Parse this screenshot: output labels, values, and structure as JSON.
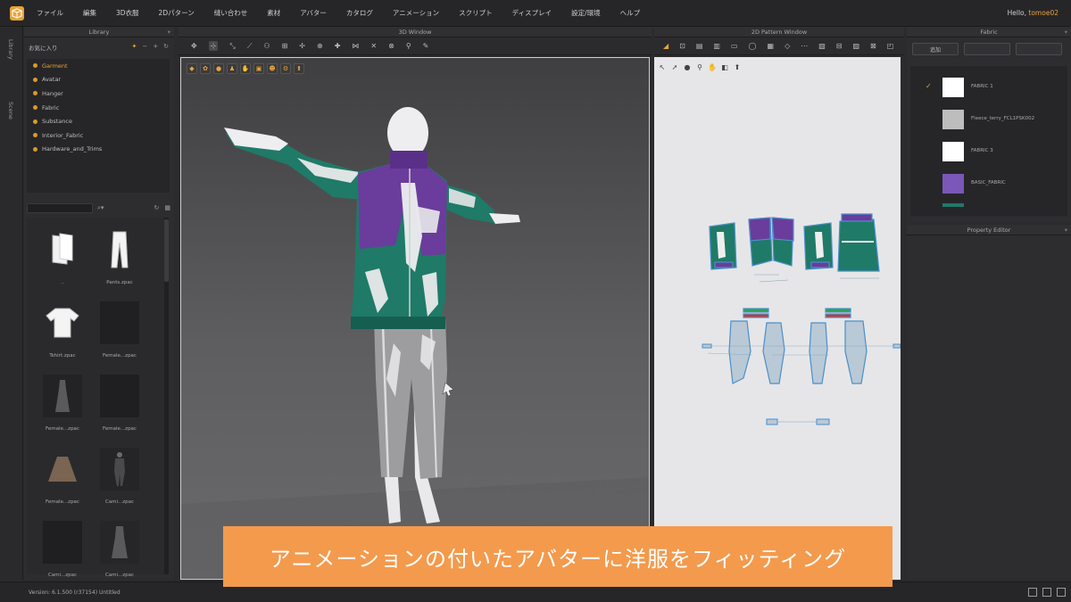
{
  "menubar": {
    "items": [
      "ファイル",
      "編集",
      "3D衣服",
      "2Dパターン",
      "縫い合わせ",
      "素材",
      "アバター",
      "カタログ",
      "アニメーション",
      "スクリプト",
      "ディスプレイ",
      "設定/環境",
      "ヘルプ"
    ],
    "greeting": "Hello,",
    "user": "tomoe02"
  },
  "side_tabs": [
    "Library",
    "Scene"
  ],
  "library": {
    "title": "Library",
    "fav_label": "お気に入り",
    "tree": [
      "Garment",
      "Avatar",
      "Hanger",
      "Fabric",
      "Substance",
      "Interior_Fabric",
      "Hardware_and_Trims"
    ],
    "search_placeholder": "",
    "thumbs": [
      "..",
      "Pants.zpac",
      "Tshirt.zpac",
      "Female...zpac",
      "Female...zpac",
      "Female...zpac",
      "Female...zpac",
      "Cami...zpac",
      "Cami...zpac",
      "Cami...zpac"
    ]
  },
  "win3d": {
    "title": "3D Window"
  },
  "win2d": {
    "title": "2D Pattern Window"
  },
  "fabric": {
    "title": "Fabric",
    "items": [
      {
        "name": "FABRIC 1",
        "color": "#ffffff",
        "checked": true
      },
      {
        "name": "Fleece_terry_FCL1PSK002",
        "color": "#bdbdbd",
        "checked": false
      },
      {
        "name": "FABRIC 3",
        "color": "#ffffff",
        "checked": false
      },
      {
        "name": "BASIC_FABRIC",
        "color": "#7a57b8",
        "checked": false
      }
    ]
  },
  "property_editor": {
    "title": "Property Editor"
  },
  "status": {
    "text": "Version:  6.1.500 (r37154)    Untitled"
  },
  "caption": "アニメーションの付いたアバターに洋服をフィッティング",
  "colors": {
    "accent": "#e8a33a",
    "caption_bg": "#f39a4d",
    "jacket_green": "#1f7a67",
    "jacket_purple": "#6a3c9c"
  }
}
